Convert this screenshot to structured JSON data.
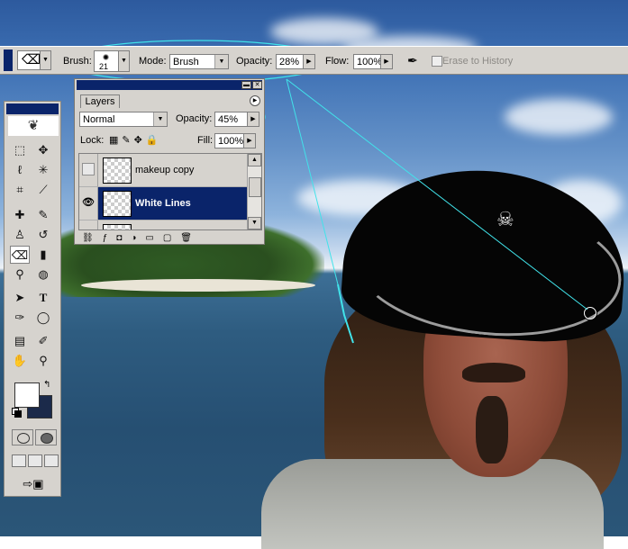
{
  "options_bar": {
    "tool_icon": "eraser-icon",
    "brush_label": "Brush:",
    "brush_size": "21",
    "mode_label": "Mode:",
    "mode_value": "Brush",
    "opacity_label": "Opacity:",
    "opacity_value": "28%",
    "flow_label": "Flow:",
    "flow_value": "100%",
    "airbrush_icon": "airbrush-icon",
    "erase_to_history_label": "Erase to History",
    "erase_to_history_checked": false
  },
  "toolbox": {
    "icons": [
      "marquee-icon",
      "move-icon",
      "lasso-icon",
      "magic-wand-icon",
      "crop-icon",
      "slice-icon",
      "healing-brush-icon",
      "brush-icon",
      "clone-stamp-icon",
      "history-brush-icon",
      "eraser-icon",
      "gradient-icon",
      "dodge-icon",
      "burn-icon",
      "path-select-icon",
      "type-icon",
      "pen-icon",
      "ellipse-icon",
      "notes-icon",
      "eyedropper-icon",
      "hand-icon",
      "zoom-icon"
    ],
    "foreground_color": "#ffffff",
    "background_color": "#1b2a4a"
  },
  "layers_panel": {
    "tab_label": "Layers",
    "blend_mode": "Normal",
    "opacity_label": "Opacity:",
    "opacity_value": "45%",
    "lock_label": "Lock:",
    "fill_label": "Fill:",
    "fill_value": "100%",
    "layers": [
      {
        "name": "makeup copy",
        "visible": false,
        "selected": false
      },
      {
        "name": "White Lines",
        "visible": true,
        "selected": true
      },
      {
        "name": "",
        "visible": false,
        "selected": false
      }
    ]
  },
  "colors": {
    "title_bar": "#0a246a",
    "panel_bg": "#d6d3ce",
    "annotation": "#41e3ea"
  }
}
